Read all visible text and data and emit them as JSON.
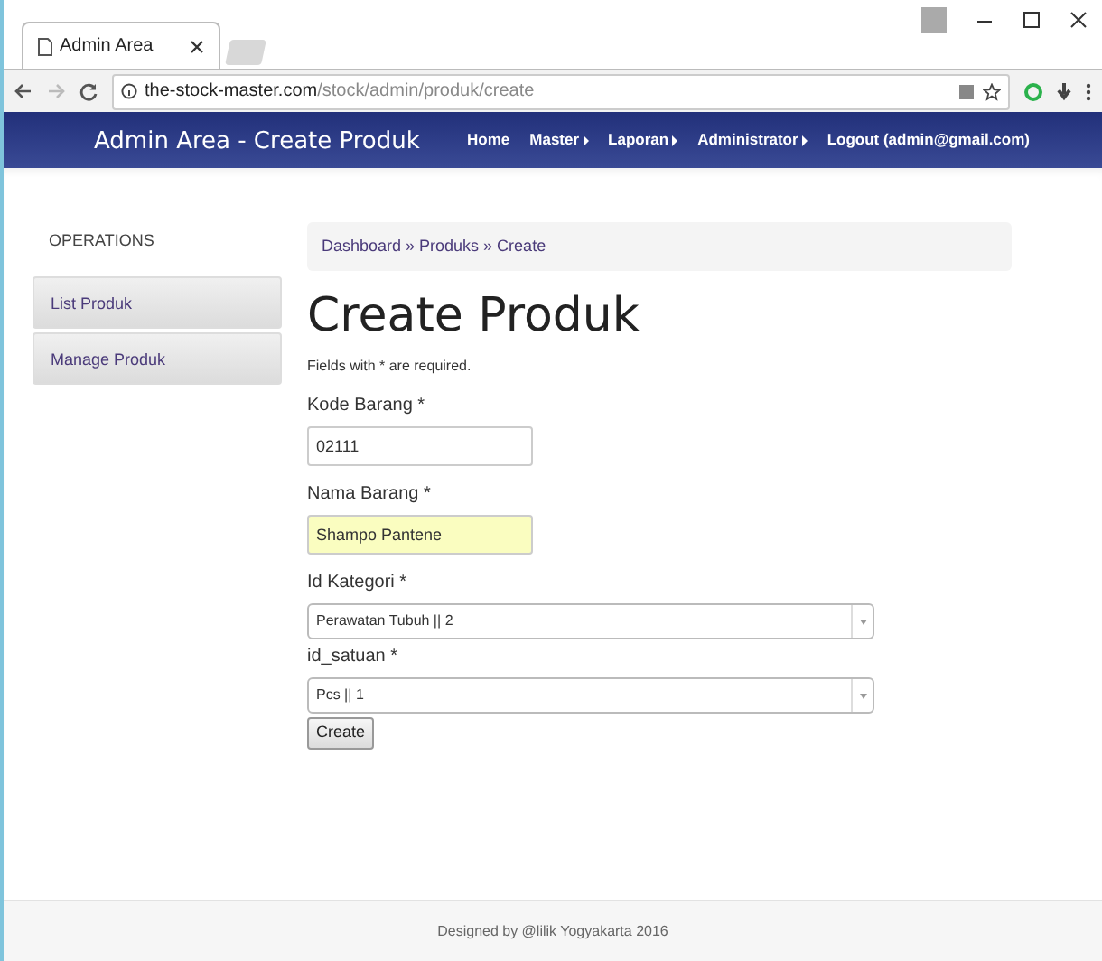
{
  "browser": {
    "tab_title": "Admin Area",
    "url_host": "the-stock-master.com",
    "url_path": "/stock/admin/produk/create"
  },
  "navbar": {
    "title": "Admin Area - Create Produk",
    "items": [
      {
        "label": "Home",
        "has_submenu": false
      },
      {
        "label": "Master",
        "has_submenu": true
      },
      {
        "label": "Laporan",
        "has_submenu": true
      },
      {
        "label": "Administrator",
        "has_submenu": true
      },
      {
        "label": "Logout (admin@gmail.com)",
        "has_submenu": false
      }
    ]
  },
  "sidebar": {
    "heading": "OPERATIONS",
    "items": [
      {
        "label": "List Produk"
      },
      {
        "label": "Manage Produk"
      }
    ]
  },
  "breadcrumb": "Dashboard » Produks » Create",
  "page_title": "Create Produk",
  "note": "Fields with * are required.",
  "fields": [
    {
      "kind": "input",
      "label": "Kode Barang *",
      "value": "02111",
      "autofilled": false
    },
    {
      "kind": "input",
      "label": "Nama Barang *",
      "value": "Shampo Pantene",
      "autofilled": true
    },
    {
      "kind": "select",
      "label": "Id Kategori *",
      "value": "Perawatan Tubuh || 2"
    },
    {
      "kind": "select",
      "label": "id_satuan *",
      "value": "Pcs || 1"
    }
  ],
  "submit": "Create",
  "footer": "Designed by @lilik Yogyakarta 2016"
}
